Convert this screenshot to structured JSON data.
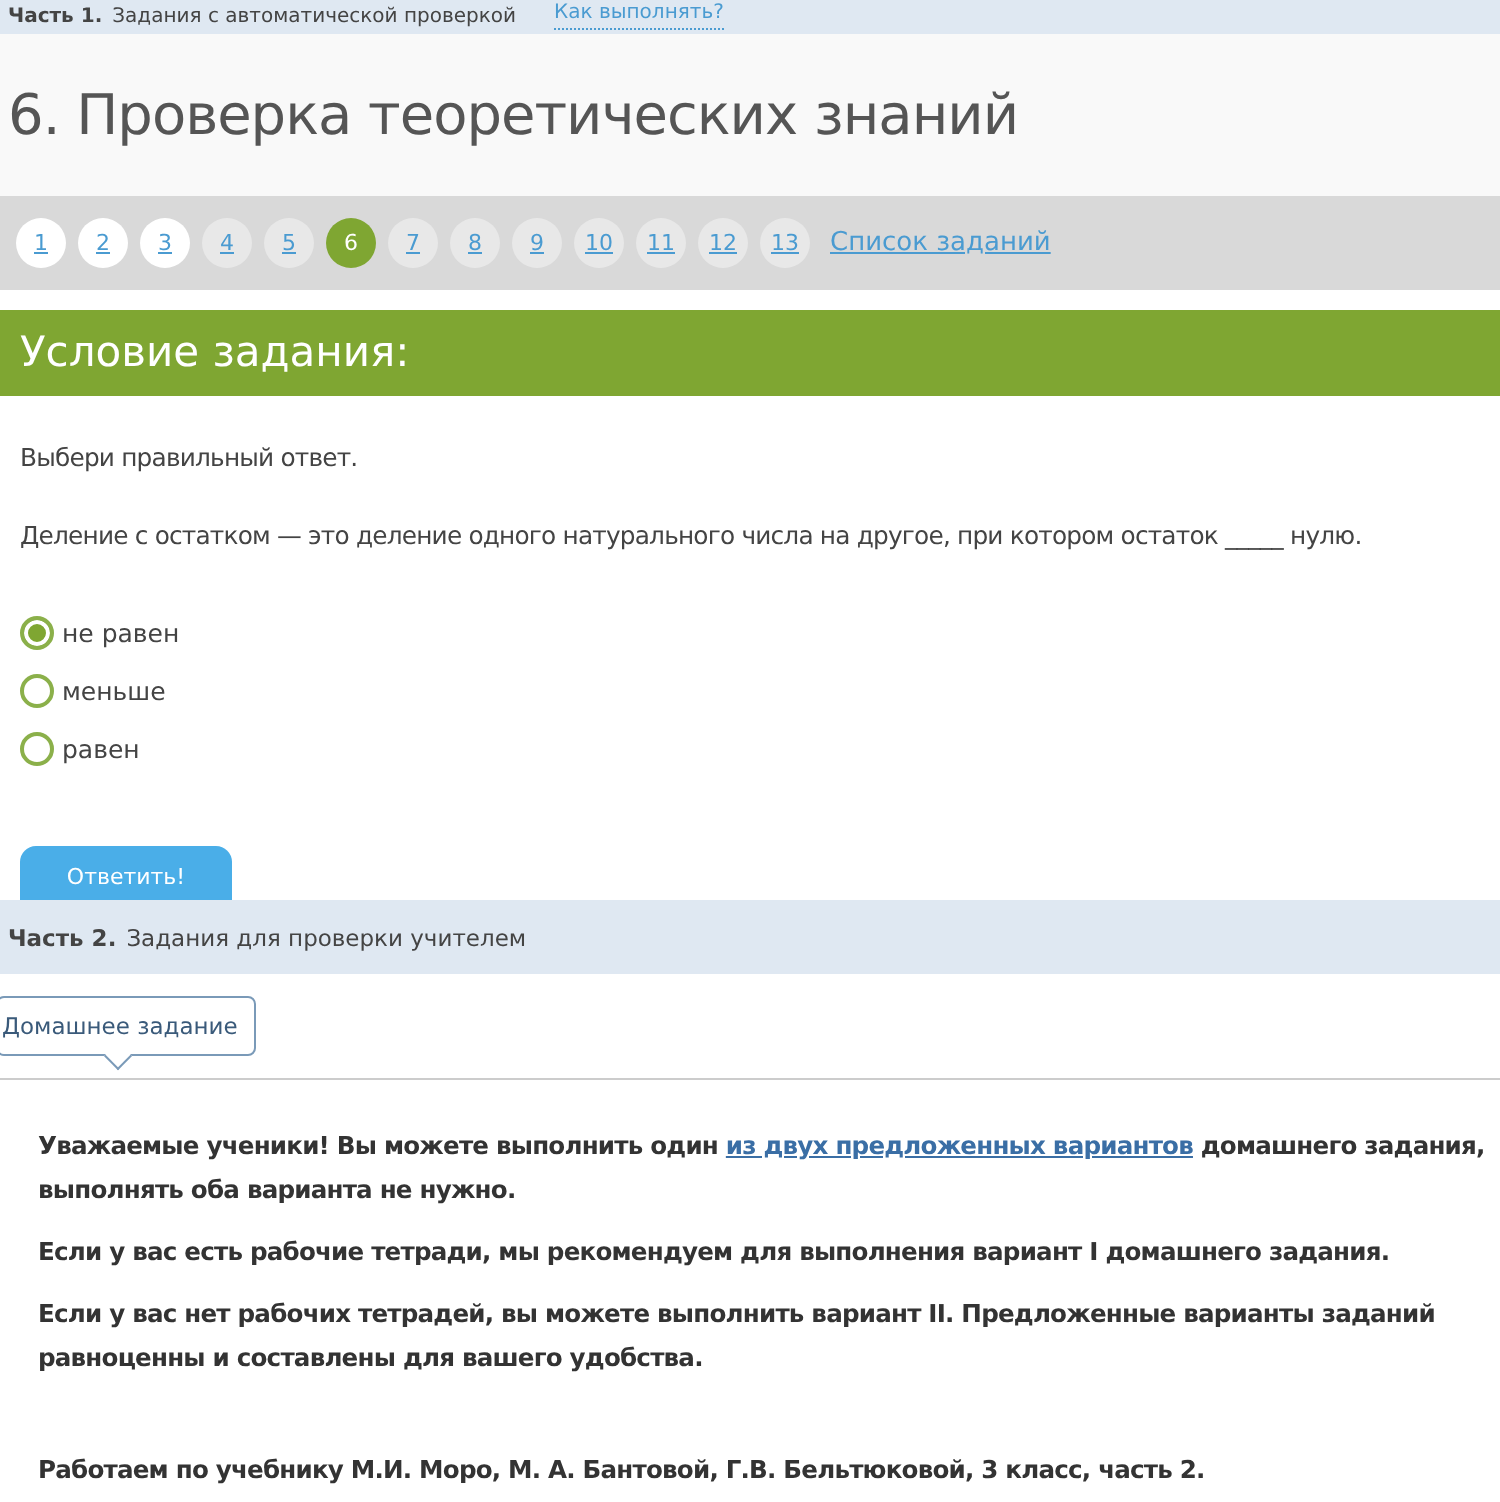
{
  "part1_bar": {
    "label": "Часть 1.",
    "text": "Задания с автоматической проверкой",
    "link": "Как выполнять?"
  },
  "title": "6. Проверка теоретических знаний",
  "pager": {
    "pages": [
      {
        "label": "1",
        "selected": false,
        "visited": true
      },
      {
        "label": "2",
        "selected": false,
        "visited": true
      },
      {
        "label": "3",
        "selected": false,
        "visited": true
      },
      {
        "label": "4",
        "selected": false,
        "visited": false
      },
      {
        "label": "5",
        "selected": false,
        "visited": false
      },
      {
        "label": "6",
        "selected": true,
        "visited": false
      },
      {
        "label": "7",
        "selected": false,
        "visited": false
      },
      {
        "label": "8",
        "selected": false,
        "visited": false
      },
      {
        "label": "9",
        "selected": false,
        "visited": false
      },
      {
        "label": "10",
        "selected": false,
        "visited": false
      },
      {
        "label": "11",
        "selected": false,
        "visited": false
      },
      {
        "label": "12",
        "selected": false,
        "visited": false
      },
      {
        "label": "13",
        "selected": false,
        "visited": false
      }
    ],
    "list_link": "Список заданий"
  },
  "task": {
    "header": "Условие задания:",
    "instruction": "Выбери правильный ответ.",
    "question": "Деление с остатком — это деление одного натурального числа на другое, при котором остаток _____ нулю.",
    "options": [
      {
        "label": "не равен",
        "selected": true
      },
      {
        "label": "меньше",
        "selected": false
      },
      {
        "label": "равен",
        "selected": false
      }
    ],
    "submit": "Ответить!"
  },
  "part2_bar": {
    "label": "Часть 2.",
    "text": "Задания для проверки учителем"
  },
  "tab": "Домашнее задание",
  "intro": {
    "before": "Уважаемые ученики! Вы можете выполнить один",
    "link": "из двух предложенных вариантов",
    "after": "домашнего задания, выполнять оба варианта не нужно."
  },
  "paragraphs": [
    "Если у вас есть рабочие тетради, мы рекомендуем для выполнения вариант I домашнего задания.",
    "Если у вас нет рабочих тетрадей, вы можете выполнить вариант II. Предложенные варианты заданий равноценны и составлены для вашего удобства."
  ],
  "footer_note": "Работаем по учебнику М.И. Моро, М. А. Бантовой, Г.В. Бельтюковой, 3 класс, часть 2."
}
